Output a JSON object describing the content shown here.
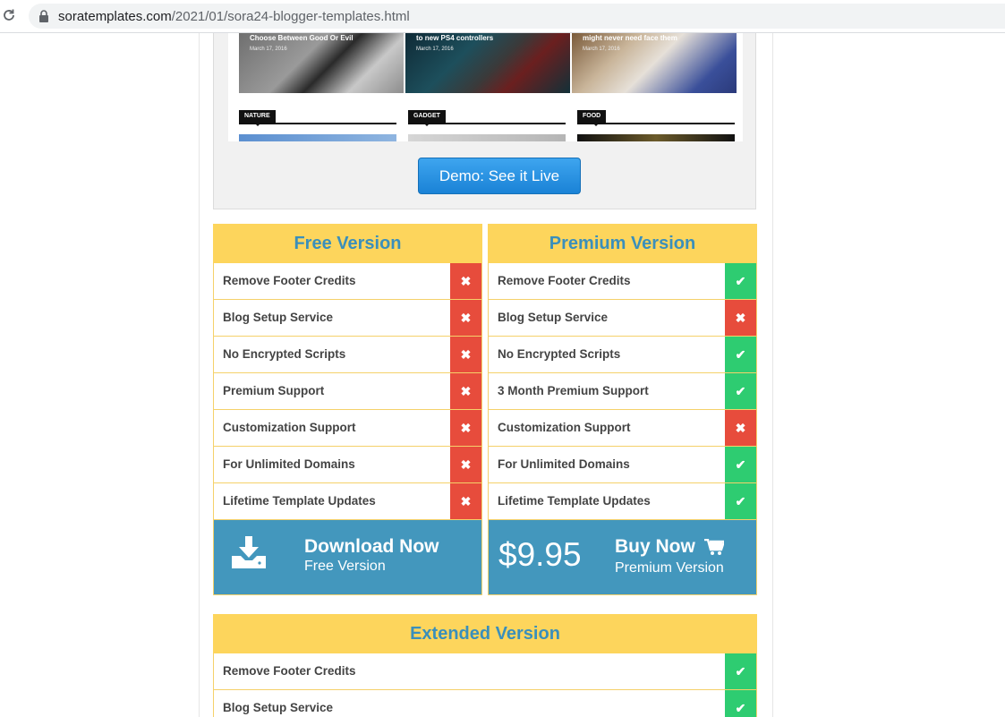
{
  "browser": {
    "url_domain": "soratemplates.com",
    "url_path": "/2021/01/sora24-blogger-templates.html"
  },
  "preview": {
    "posts": [
      {
        "title": "Choose Between Good Or Evil",
        "date": "March 17, 2016"
      },
      {
        "title": "to new PS4 controllers",
        "date": "March 17, 2016"
      },
      {
        "title": "might never need face them",
        "date": "March 17, 2016"
      }
    ],
    "categories": [
      "NATURE",
      "GADGET",
      "FOOD"
    ]
  },
  "demo_button": "Demo: See it Live",
  "free": {
    "title": "Free Version",
    "features": [
      {
        "label": "Remove Footer Credits",
        "included": false
      },
      {
        "label": "Blog Setup Service",
        "included": false
      },
      {
        "label": "No Encrypted Scripts",
        "included": false
      },
      {
        "label": "Premium Support",
        "included": false
      },
      {
        "label": "Customization Support",
        "included": false
      },
      {
        "label": "For Unlimited Domains",
        "included": false
      },
      {
        "label": "Lifetime Template Updates",
        "included": false
      }
    ],
    "cta_title": "Download Now",
    "cta_subtitle": "Free Version"
  },
  "premium": {
    "title": "Premium Version",
    "features": [
      {
        "label": "Remove Footer Credits",
        "included": true
      },
      {
        "label": "Blog Setup Service",
        "included": false
      },
      {
        "label": "No Encrypted Scripts",
        "included": true
      },
      {
        "label": "3 Month Premium Support",
        "included": true
      },
      {
        "label": "Customization Support",
        "included": false
      },
      {
        "label": "For Unlimited Domains",
        "included": true
      },
      {
        "label": "Lifetime Template Updates",
        "included": true
      }
    ],
    "price": "$9.95",
    "cta_title": "Buy Now",
    "cta_subtitle": "Premium Version"
  },
  "extended": {
    "title": "Extended Version",
    "features": [
      {
        "label": "Remove Footer Credits",
        "included": true
      },
      {
        "label": "Blog Setup Service",
        "included": true
      }
    ]
  },
  "icons": {
    "check": "✔",
    "cross": "✖"
  },
  "colors": {
    "header_bg": "#fdd55c",
    "header_text": "#3a8fbb",
    "no_mark": "#e74c3c",
    "yes_mark": "#2ecc71",
    "cta_bg": "#4397bd"
  }
}
